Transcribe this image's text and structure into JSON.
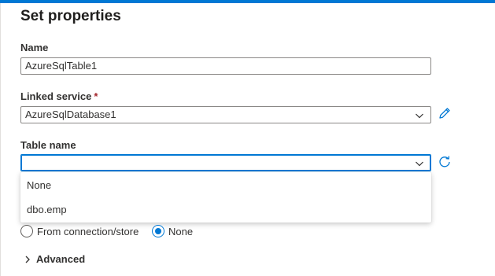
{
  "panel": {
    "title": "Set properties"
  },
  "name_field": {
    "label": "Name",
    "value": "AzureSqlTable1"
  },
  "linked_service": {
    "label": "Linked service",
    "required_marker": "*",
    "value": "AzureSqlDatabase1",
    "edit_icon": "pencil-icon"
  },
  "table_name": {
    "label": "Table name",
    "value": "",
    "refresh_icon": "refresh-icon",
    "options": [
      "None",
      "dbo.emp"
    ]
  },
  "import_schema": {
    "options": [
      {
        "label": "From connection/store",
        "checked": false
      },
      {
        "label": "None",
        "checked": true
      }
    ]
  },
  "advanced": {
    "label": "Advanced",
    "icon": "chevron-right-icon"
  },
  "colors": {
    "accent": "#0078d4",
    "required": "#a4262c"
  }
}
